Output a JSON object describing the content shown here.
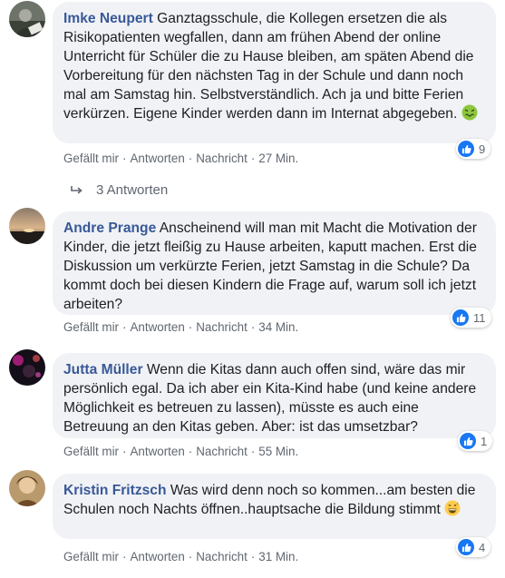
{
  "comments": [
    {
      "author": "Imke Neupert",
      "text": "Ganztagsschule, die Kollegen ersetzen die als Risikopatienten wegfallen, dann am frühen Abend der online Unterricht für Schüler die zu Hause bleiben, am späten Abend die Vorbereitung für den nächsten Tag in der Schule und dann noch mal am Samstag hin. Selbstverständlich. Ach ja und bitte Ferien verkürzen. Eigene Kinder werden dann im Internat abgegeben.",
      "emoji": "nauseated-face-icon",
      "likes": "9",
      "actions": {
        "like": "Gefällt mir",
        "reply": "Antworten",
        "message": "Nachricht",
        "time": "27 Min."
      }
    },
    {
      "author": "Andre Prange",
      "text": "Anscheinend will man mit Macht die Motivation der Kinder, die jetzt fleißig zu Hause arbeiten, kaputt machen. Erst die Diskussion um verkürzte Ferien, jetzt Samstag in die Schule? Da kommt doch bei diesen Kindern die Frage auf, warum soll ich jetzt arbeiten?",
      "likes": "11",
      "actions": {
        "like": "Gefällt mir",
        "reply": "Antworten",
        "message": "Nachricht",
        "time": "34 Min."
      }
    },
    {
      "author": "Jutta Müller",
      "text": "Wenn die Kitas dann auch offen sind, wäre das mir persönlich egal. Da ich aber ein Kita-Kind habe (und keine andere Möglichkeit es betreuen zu lassen), müsste es auch eine Betreuung an den Kitas geben. Aber: ist das umsetzbar?",
      "likes": "1",
      "actions": {
        "like": "Gefällt mir",
        "reply": "Antworten",
        "message": "Nachricht",
        "time": "55 Min."
      }
    },
    {
      "author": "Kristin Fritzsch",
      "text": "Was wird denn noch so kommen...am besten die Schulen noch Nachts öffnen..hauptsache die Bildung stimmt",
      "emoji": "grinning-sweat-face-icon",
      "likes": "4",
      "actions": {
        "like": "Gefällt mir",
        "reply": "Antworten",
        "message": "Nachricht",
        "time": "31 Min."
      }
    }
  ],
  "replies_link": "3 Antworten",
  "colors": {
    "author": "#385898",
    "bubble": "#f0f2f5",
    "like_badge": "#1877f2",
    "meta": "#606770"
  }
}
